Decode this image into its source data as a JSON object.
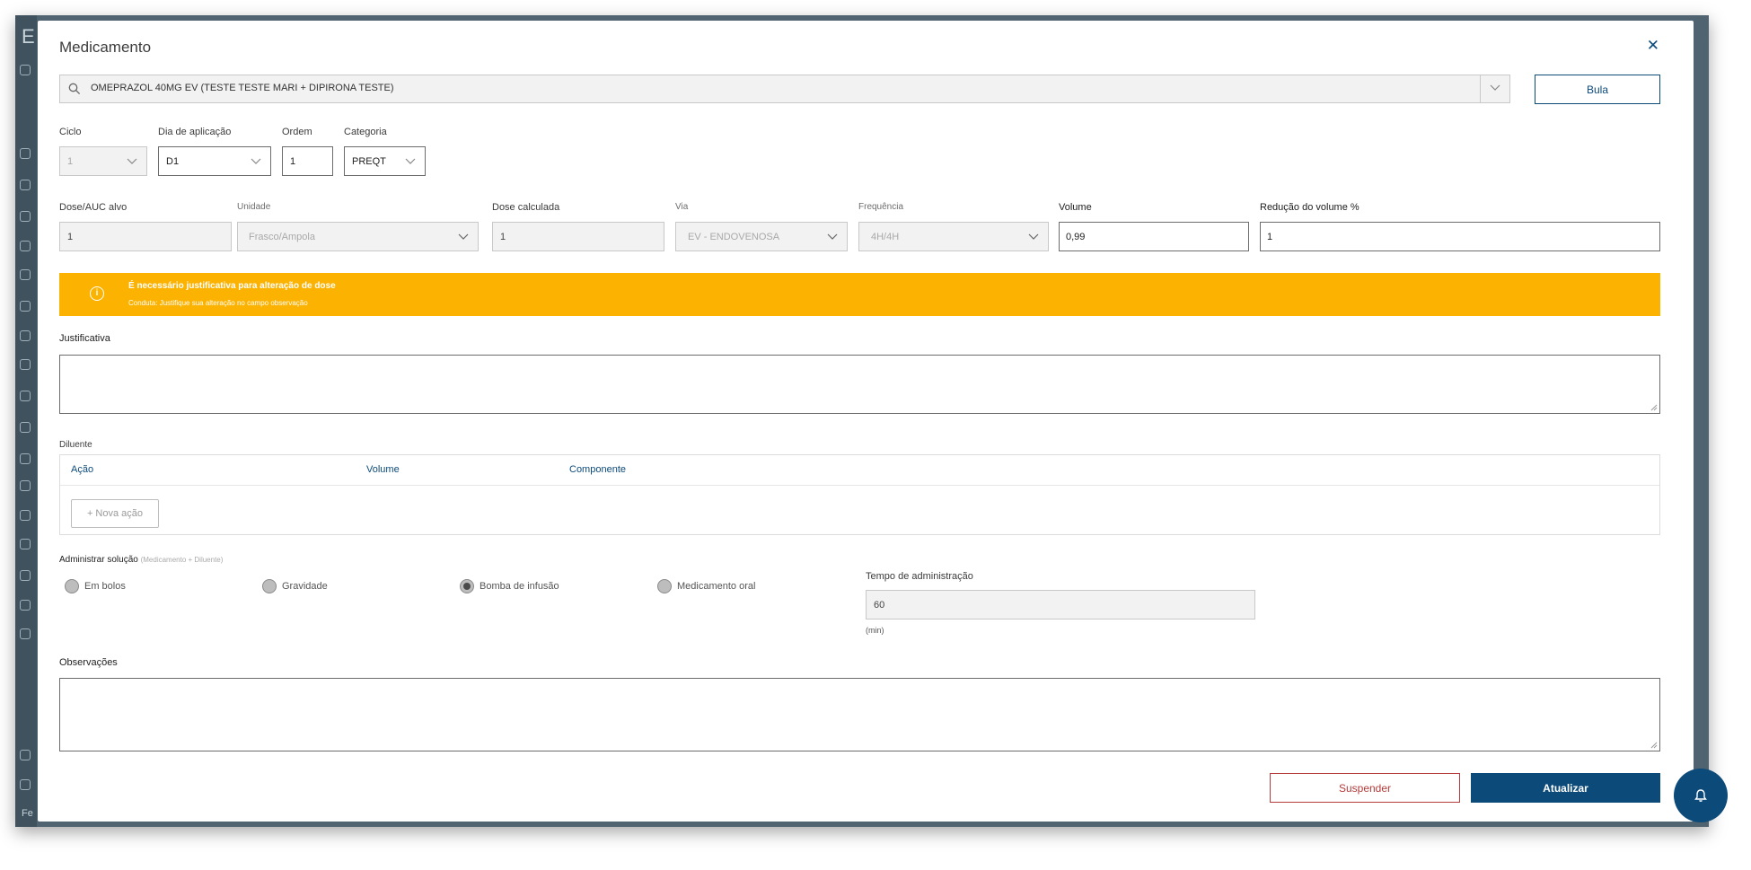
{
  "background": {
    "sidebar_letter": "E",
    "footer_label": "Fe"
  },
  "modal": {
    "title": "Medicamento",
    "close_icon": "close-icon"
  },
  "search": {
    "value": "OMEPRAZOL 40MG EV (TESTE TESTE MARI + DIPIRONA TESTE)",
    "icon": "search-icon"
  },
  "buttons": {
    "bula": "Bula",
    "nova_acao": "+ Nova ação",
    "suspender": "Suspender",
    "atualizar": "Atualizar"
  },
  "row1": {
    "ciclo": {
      "label": "Ciclo",
      "value": "1"
    },
    "dia": {
      "label": "Dia de aplicação",
      "value": "D1"
    },
    "ordem": {
      "label": "Ordem",
      "value": "1"
    },
    "categoria": {
      "label": "Categoria",
      "value": "PREQT"
    }
  },
  "row2": {
    "dose": {
      "label": "Dose/AUC alvo",
      "value": "1"
    },
    "unidade": {
      "label": "Unidade",
      "value": "Frasco/Ampola"
    },
    "dose_calc": {
      "label": "Dose calculada",
      "value": "1"
    },
    "via": {
      "label": "Via",
      "value": "EV - ENDOVENOSA"
    },
    "frequencia": {
      "label": "Frequência",
      "value": "4H/4H"
    },
    "volume": {
      "label": "Volume",
      "value": "0,99"
    },
    "reducao": {
      "label": "Redução do volume %",
      "value": "1"
    }
  },
  "alert": {
    "title": "É necessário justificativa para alteração de dose",
    "subtitle": "Conduta: Justifique sua alteração no campo observação",
    "icon_glyph": "i",
    "color": "#fbb200"
  },
  "justificativa": {
    "label": "Justificativa"
  },
  "diluente": {
    "label": "Diluente",
    "columns": [
      "Ação",
      "Volume",
      "Componente"
    ]
  },
  "administrar": {
    "label": "Administrar solução",
    "hint": "(Medicamento + Diluente)",
    "options": [
      "Em bolos",
      "Gravidade",
      "Bomba de infusão",
      "Medicamento oral"
    ],
    "selected": "Bomba de infusão"
  },
  "tempo": {
    "label": "Tempo de administração",
    "value": "60",
    "unit": "(min)"
  },
  "observacoes": {
    "label": "Observações"
  },
  "colors": {
    "primary": "#0c4a7a",
    "danger": "#b33b3b",
    "warning": "#fbb200"
  }
}
